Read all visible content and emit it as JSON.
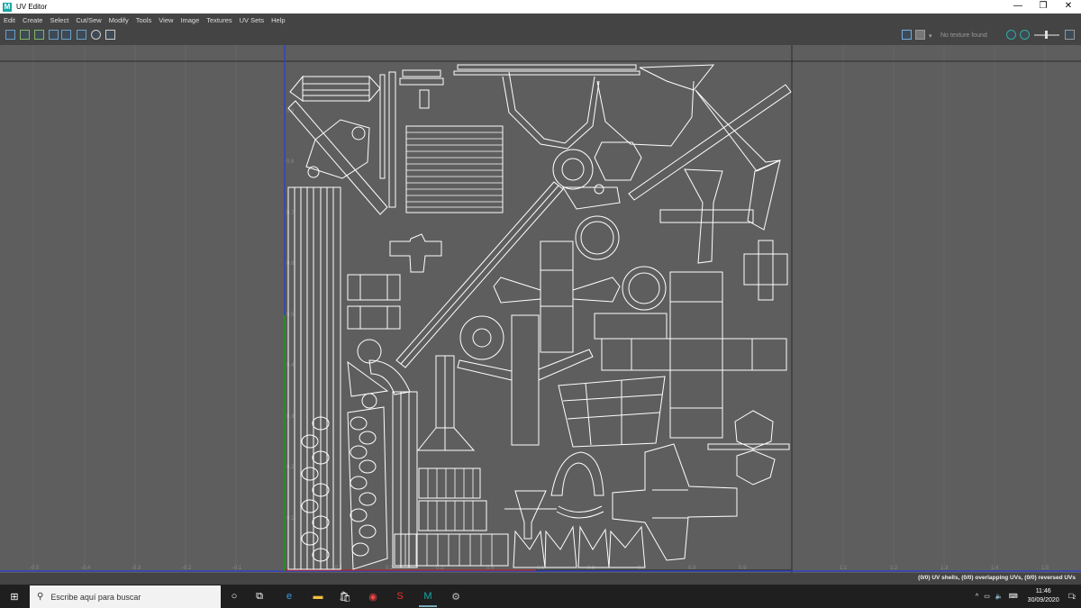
{
  "window": {
    "title": "UV Editor",
    "logo": "M"
  },
  "window_controls": {
    "minimize": "—",
    "restore": "❐",
    "close": "✕"
  },
  "menu": [
    "Edit",
    "Create",
    "Select",
    "Cut/Sew",
    "Modify",
    "Tools",
    "View",
    "Image",
    "Textures",
    "UV Sets",
    "Help"
  ],
  "toolbar": {
    "texture_status": "No texture found"
  },
  "axis": {
    "x_ticks": [
      "-0.5",
      "-0.4",
      "-0.3",
      "-0.2",
      "-0.1",
      "0.1",
      "0.2",
      "0.3",
      "0.4",
      "0.5",
      "0.6",
      "0.7",
      "0.8",
      "0.9",
      "1.1",
      "1.2",
      "1.3",
      "1.4",
      "1.5"
    ],
    "y_ticks": [
      "0.9",
      "0.8",
      "0.7",
      "0.6",
      "0.5",
      "0.4",
      "0.3",
      "0.2",
      "0.1"
    ]
  },
  "status": {
    "text": "(0/0) UV shells, (0/0) overlapping UVs, (0/0) reversed UVs"
  },
  "taskbar": {
    "search_placeholder": "Escribe aquí para buscar",
    "time": "11:46",
    "date": "30/09/2020",
    "notifications": "2"
  },
  "colors": {
    "viewport": "#5e5e5e",
    "uv_wire": "#ffffff",
    "axis_u": "#3040c0",
    "axis_v": "#2a8a2a",
    "taskbar": "#1f1f1f"
  }
}
